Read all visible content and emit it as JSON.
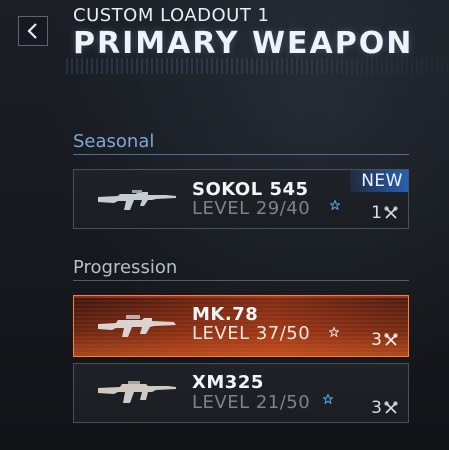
{
  "header": {
    "subtitle": "CUSTOM LOADOUT 1",
    "title": "PRIMARY WEAPON"
  },
  "sections": {
    "seasonal": {
      "label": "Seasonal",
      "weapons": [
        {
          "name": "SOKOL 545",
          "level": "LEVEL 29/40",
          "count": "1",
          "badge": "NEW",
          "icon": "assault-rifle-icon"
        }
      ]
    },
    "progression": {
      "label": "Progression",
      "weapons": [
        {
          "name": "MK.78",
          "level": "LEVEL 37/50",
          "count": "3",
          "selected": true,
          "icon": "lmg-icon"
        },
        {
          "name": "XM325",
          "level": "LEVEL 21/50",
          "count": "3",
          "icon": "rifle-icon"
        }
      ]
    }
  },
  "colors": {
    "seasonal_accent": "#7fa6d8",
    "selected_accent": "#ff7d3a",
    "new_badge": "#2a5fb4"
  }
}
